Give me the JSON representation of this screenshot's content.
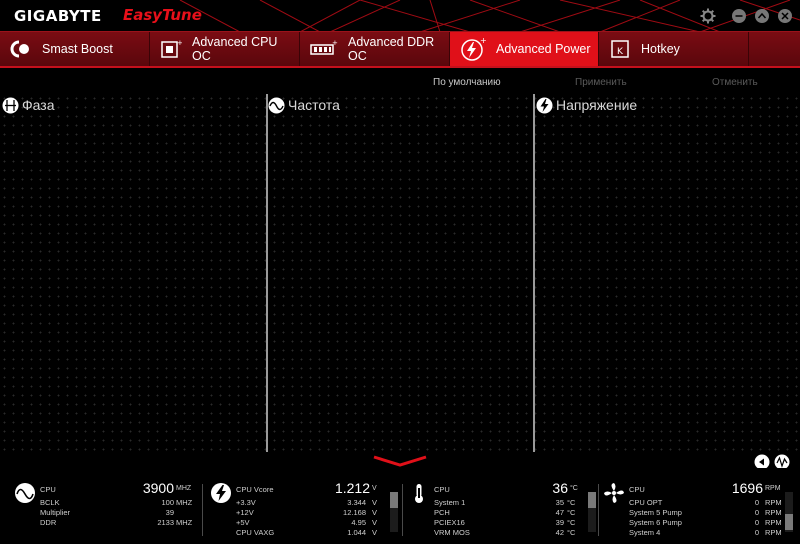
{
  "app": {
    "brand": "GIGABYTE",
    "product": "EasyTune"
  },
  "tabs": [
    {
      "label": "Smast Boost",
      "icon": "smart-boost-icon"
    },
    {
      "label": "Advanced CPU OC",
      "icon": "cpu-chip-icon"
    },
    {
      "label": "Advanced DDR OC",
      "icon": "memory-module-icon"
    },
    {
      "label": "Advanced Power",
      "icon": "power-bolt-icon",
      "active": true
    },
    {
      "label": "Hotkey",
      "icon": "keyboard-key-icon"
    }
  ],
  "actions": {
    "default": "По умолчанию",
    "apply": "Применить",
    "cancel": "Отменить"
  },
  "panels": [
    {
      "title": "Фаза",
      "icon": "phase-icon"
    },
    {
      "title": "Частота",
      "icon": "frequency-icon"
    },
    {
      "title": "Напряжение",
      "icon": "voltage-icon"
    }
  ],
  "monitor": {
    "freq": {
      "label": "CPU",
      "value": "3900",
      "unit": "MHZ",
      "rows": [
        {
          "name": "BCLK",
          "value": "100",
          "unit": "MHZ"
        },
        {
          "name": "Multiplier",
          "value": "39",
          "unit": ""
        },
        {
          "name": "DDR",
          "value": "2133",
          "unit": "MHZ"
        }
      ]
    },
    "voltage": {
      "label": "CPU Vcore",
      "value": "1.212",
      "unit": "V",
      "rows": [
        {
          "name": "+3.3V",
          "value": "3.344",
          "unit": "V"
        },
        {
          "name": "+12V",
          "value": "12.168",
          "unit": "V"
        },
        {
          "name": "+5V",
          "value": "4.95",
          "unit": "V"
        },
        {
          "name": "CPU VAXG",
          "value": "1.044",
          "unit": "V"
        }
      ]
    },
    "temperature": {
      "label": "CPU",
      "value": "36",
      "unit": "°C",
      "rows": [
        {
          "name": "System 1",
          "value": "35",
          "unit": "°C"
        },
        {
          "name": "PCH",
          "value": "47",
          "unit": "°C"
        },
        {
          "name": "PCIEX16",
          "value": "39",
          "unit": "°C"
        },
        {
          "name": "VRM MOS",
          "value": "42",
          "unit": "°C"
        }
      ]
    },
    "fan": {
      "label": "CPU",
      "value": "1696",
      "unit": "RPM",
      "rows": [
        {
          "name": "CPU OPT",
          "value": "0",
          "unit": "RPM"
        },
        {
          "name": "System 5 Pump",
          "value": "0",
          "unit": "RPM"
        },
        {
          "name": "System 6 Pump",
          "value": "0",
          "unit": "RPM"
        },
        {
          "name": "System 4",
          "value": "0",
          "unit": "RPM"
        }
      ]
    }
  },
  "colors": {
    "accent": "#e01019",
    "tab_bg": "#6b0a10",
    "divider": "#9a9a9a"
  }
}
